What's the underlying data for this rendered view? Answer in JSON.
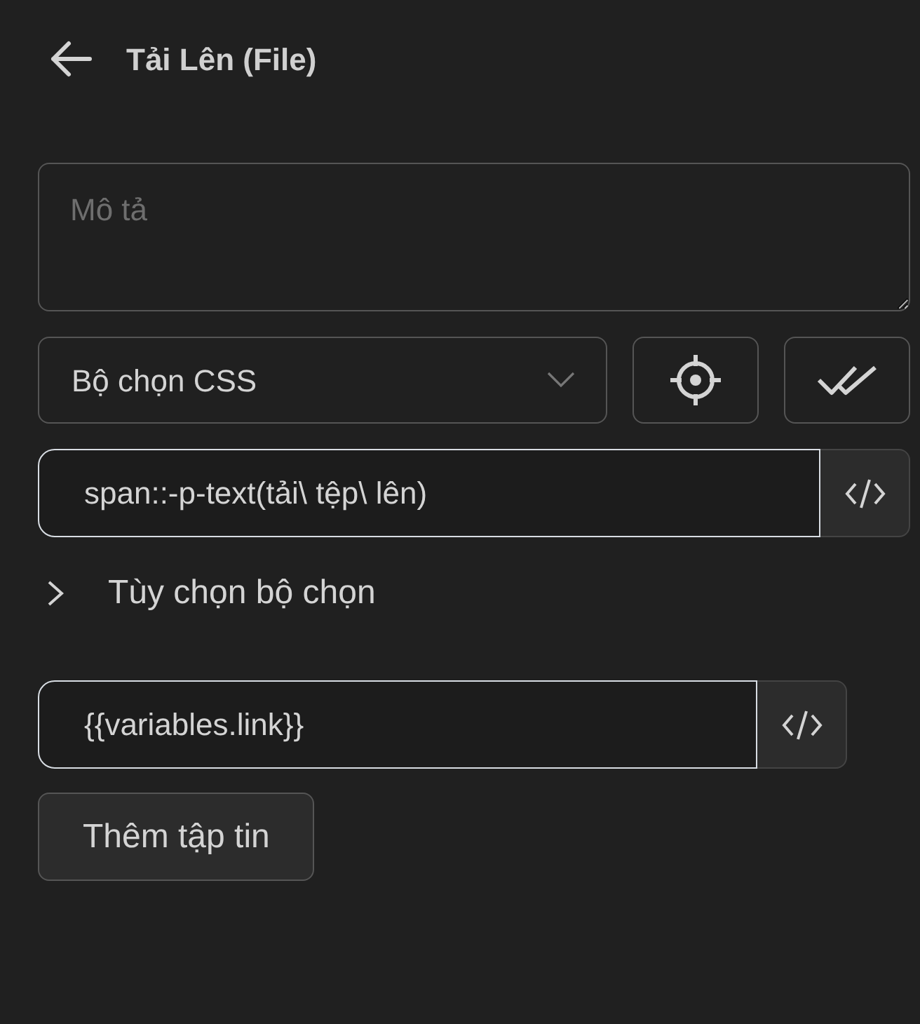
{
  "header": {
    "title": "Tải Lên (File)"
  },
  "description": {
    "placeholder": "Mô tả"
  },
  "selector_type": {
    "value": "Bộ chọn CSS"
  },
  "selector": {
    "value": "span::-p-text(tải\\ tệp\\ lên)"
  },
  "selector_options": {
    "label": "Tùy chọn bộ chọn",
    "expanded": false
  },
  "file_path": {
    "value": "{{variables.link}}"
  },
  "add_file_button": {
    "label": "Thêm tập tin"
  }
}
